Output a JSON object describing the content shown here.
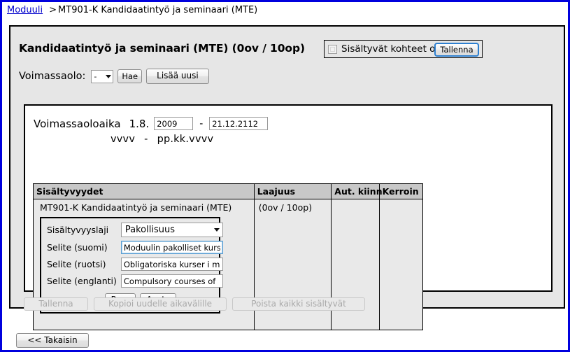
{
  "breadcrumb": {
    "link": "Moduuli",
    "separator": ">",
    "current": "MT901-K Kandidaatintyö ja seminaari (MTE)"
  },
  "panel": {
    "title": "Kandidaatintyö ja seminaari (MTE) (0ov / 10op)",
    "ohjeelliset": {
      "checkbox_label": "Sisältyvät kohteet ohjeellisia",
      "checked": false,
      "save_label": "Tallenna"
    },
    "voimassaolo": {
      "label": "Voimassaolo:",
      "select_value": "-",
      "search_label": "Hae",
      "add_label": "Lisää uusi"
    }
  },
  "inner": {
    "validity": {
      "title": "Voimassaoloaika",
      "start_prefix": "1.8.",
      "start_value": "2009",
      "dash": "-",
      "end_value": "21.12.2112",
      "hint_start": "vvvv",
      "hint_dash": "-",
      "hint_end": "pp.kk.vvvv"
    },
    "table": {
      "headers": [
        "Sisältyvyydet",
        "Laajuus",
        "Aut. kiinn",
        "Kerroin"
      ],
      "row": {
        "name": "MT901-K Kandidaatintyö ja seminaari (MTE)",
        "laajuus": "(0ov / 10op)",
        "aut_kiinn": "",
        "kerroin": ""
      }
    },
    "edit_form": {
      "fields": [
        {
          "label": "Sisältyvyyslaji",
          "value": "Pakollisuus",
          "type": "select"
        },
        {
          "label": "Selite (suomi)",
          "value": "Moduulin pakolliset kurs",
          "type": "text",
          "focused": true
        },
        {
          "label": "Selite (ruotsi)",
          "value": "Obligatoriska kurser i m",
          "type": "text",
          "focused": false
        },
        {
          "label": "Selite (englanti)",
          "value": "Compulsory courses of",
          "type": "text",
          "focused": false
        }
      ],
      "cancel_label": "Peru",
      "apply_label": "Aseta"
    }
  },
  "bottom_bar": {
    "save_label": "Tallenna",
    "copy_label": "Kopioi uudelle aikavälille",
    "delete_label": "Poista kaikki sisältyvät"
  },
  "footer": {
    "back_label": "<< Takaisin"
  },
  "colors": {
    "page_border": "#0000dd",
    "link": "#0000cc",
    "panel_bg": "#e6e6e6",
    "inner_bg": "#ffffff",
    "table_header_bg": "#c8c8c8",
    "table_cell_bg": "#e9e9e9",
    "focus_blue": "#2c7fd0"
  }
}
